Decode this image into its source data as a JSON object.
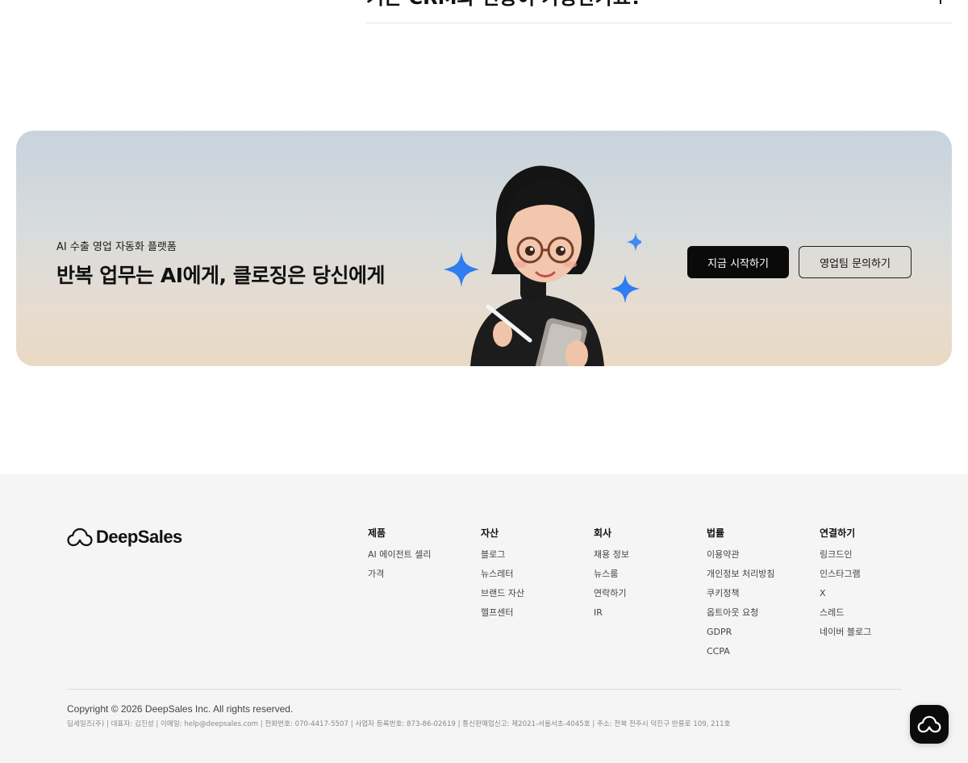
{
  "faq": {
    "question": "기존 CRM과 연동이 가능한가요?",
    "toggle_symbol": "+"
  },
  "cta": {
    "kicker": "AI 수출 영업 자동화 플랫폼",
    "title": "반복 업무는 AI에게, 클로징은 당신에게",
    "primary_button": "지금 시작하기",
    "secondary_button": "영업팀 문의하기",
    "illustration_icon": "ai-sales-agent-illustration",
    "colors": {
      "primary_bg": "#0a0a0a",
      "sparkle": "#2f7df0"
    }
  },
  "footer": {
    "logo_text": "DeepSales",
    "logo_icon": "cloud-icon",
    "columns": [
      {
        "heading": "제품",
        "links": [
          "AI 에이전트 셀리",
          "가격"
        ]
      },
      {
        "heading": "자산",
        "links": [
          "블로그",
          "뉴스레터",
          "브랜드 자산",
          "헬프센터"
        ]
      },
      {
        "heading": "회사",
        "links": [
          "채용 정보",
          "뉴스룸",
          "연락하기",
          "IR"
        ]
      },
      {
        "heading": "법률",
        "links": [
          "이용약관",
          "개인정보 처리방침",
          "쿠키정책",
          "옵트아웃 요청",
          "GDPR",
          "CCPA"
        ]
      },
      {
        "heading": "연결하기",
        "links": [
          "링크드인",
          "인스타그램",
          "X",
          "스레드",
          "네이버 블로그"
        ]
      }
    ],
    "copyright": "Copyright © 2026 DeepSales Inc. All rights reserved.",
    "corp_info": "딥세일즈(주) | 대표자: 김진성 | 이메일: help@deepsales.com | 전화번호: 070-4417-5507 | 사업자 등록번호: 873-86-02619 | 통신판매업신고: 제2021-서울서초-4045호 | 주소: 전북 전주시 덕진구 반룡로 109, 211호"
  },
  "chat_widget": {
    "icon": "cloud-chat-icon"
  }
}
